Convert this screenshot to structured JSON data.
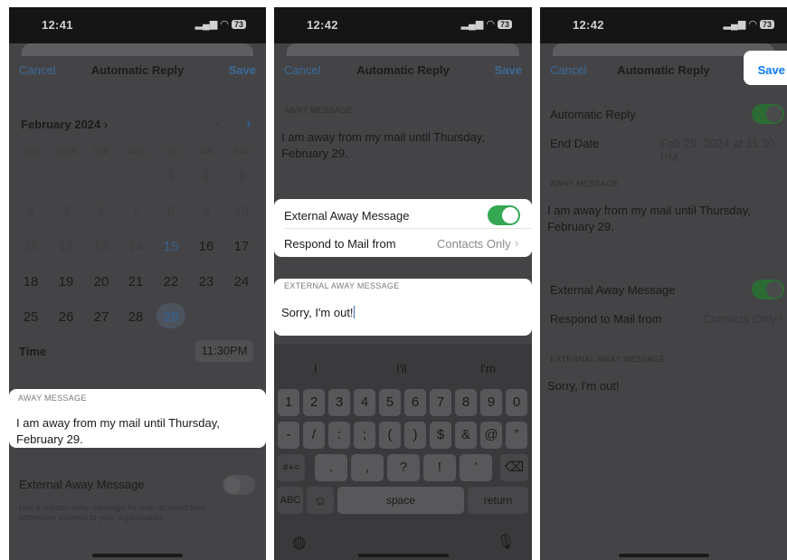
{
  "panel1": {
    "status_time": "12:41",
    "battery": "73",
    "nav": {
      "cancel": "Cancel",
      "title": "Automatic Reply",
      "save": "Save"
    },
    "calendar": {
      "month_label": "February 2024 ›",
      "weekdays": [
        "SUN",
        "MON",
        "TUE",
        "WED",
        "THU",
        "FRI",
        "SAT"
      ],
      "faint_days": [
        "1",
        "2",
        "3",
        "4",
        "5",
        "6",
        "7",
        "8",
        "9",
        "10",
        "11",
        "12",
        "13",
        "14"
      ],
      "days": [
        "15",
        "16",
        "17",
        "18",
        "19",
        "20",
        "21",
        "22",
        "23",
        "24",
        "25",
        "26",
        "27",
        "28",
        "29"
      ],
      "selected_day": "29",
      "today_day": "15"
    },
    "time_label": "Time",
    "time_value": "11:30PM",
    "away_header": "AWAY MESSAGE",
    "away_text": "I am away from my mail until Thursday, February 29.",
    "external_label": "External Away Message",
    "external_note": "Use a custom away message for mail received from addresses external to your organization."
  },
  "panel2": {
    "status_time": "12:42",
    "battery": "73",
    "nav": {
      "cancel": "Cancel",
      "title": "Automatic Reply",
      "save": "Save"
    },
    "away_header": "AWAY MESSAGE",
    "away_text": "I am away from my mail until Thursday, February 29.",
    "external_label": "External Away Message",
    "respond_label": "Respond to Mail from",
    "respond_value": "Contacts Only",
    "ext_header": "EXTERNAL AWAY MESSAGE",
    "ext_text": "Sorry, I'm out!",
    "keyboard": {
      "suggestions": [
        "I",
        "I'll",
        "I'm"
      ],
      "row1": [
        "1",
        "2",
        "3",
        "4",
        "5",
        "6",
        "7",
        "8",
        "9",
        "0"
      ],
      "row2": [
        "-",
        "/",
        ":",
        ";",
        "(",
        ")",
        "$",
        "&",
        "@",
        "”"
      ],
      "row3_left": "#+=",
      "row3": [
        ".",
        ",",
        "?",
        "!",
        "’"
      ],
      "abc": "ABC",
      "space": "space",
      "return": "return"
    }
  },
  "panel3": {
    "status_time": "12:42",
    "battery": "73",
    "nav": {
      "cancel": "Cancel",
      "title": "Automatic Reply",
      "save": "Save"
    },
    "auto_reply_label": "Automatic Reply",
    "end_date_label": "End Date",
    "end_date_value": "Feb 29, 2024 at 11:30 PM",
    "away_header": "AWAY MESSAGE",
    "away_text": "I am away from my mail until Thursday, February 29.",
    "external_label": "External Away Message",
    "respond_label": "Respond to Mail from",
    "respond_value": "Contacts Only",
    "ext_header": "EXTERNAL AWAY MESSAGE",
    "ext_text": "Sorry, I'm out!"
  },
  "colors": {
    "accent_blue": "#0a7aff",
    "toggle_green": "#34c759",
    "dim_overlay": "#444447"
  }
}
